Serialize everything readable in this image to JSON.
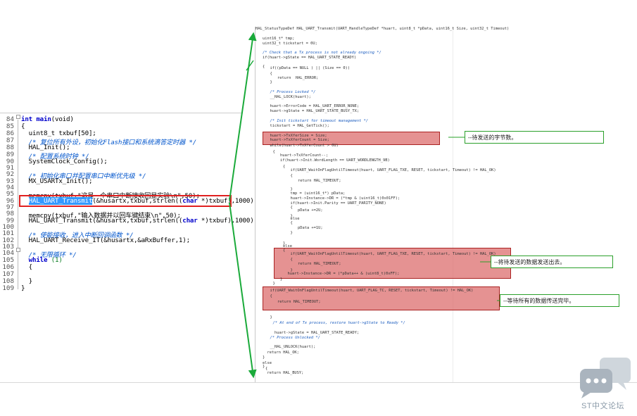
{
  "editor": {
    "line_numbers": [
      "84",
      "85",
      "86",
      "87",
      "88",
      "89",
      "90",
      "91",
      "92",
      "93",
      "94",
      "95",
      "96",
      "97",
      "98",
      "99",
      "100",
      "101",
      "102",
      "103",
      "104",
      "105",
      "106",
      "107",
      "108",
      "109"
    ],
    "lines": {
      "l84_kw1": "int",
      "l84_kw2": "main",
      "l84_rest": "(void)",
      "l85": "{",
      "l86": "  uint8_t txbuf[50];",
      "l87": "  /* 复位所有外设，初始化Flash接口和系统滴答定时器 */",
      "l88": "  HAL_Init();",
      "l89": "  /* 配置系统时钟 */",
      "l90": "  SystemClock_Config();",
      "l92": "  /* 初始化串口并配置串口中断优先级 */",
      "l93": "  MX_USARTx_Init();",
      "l95": "  memcpy(txbuf,\"这是一个串口中断接收回显实验\\n\",50);",
      "l96_sel": "HAL_UART_Transmit",
      "l96_rest_a": "(&husartx,txbuf,strlen((",
      "l96_kw": "char",
      "l96_rest_b": " *)txbuf),1000);",
      "l98": "  memcpy(txbuf,\"输入数据并以回车键结束\\n\",50);",
      "l99_a": "  HAL_UART_Transmit(&husartx,txbuf,strlen((",
      "l99_kw": "char",
      "l99_b": " *)txbuf),1000);",
      "l101": "  /* 使能接收，进入中断回调函数 */",
      "l102": "  HAL_UART_Receive_IT(&husartx,&aRxBuffer,1);",
      "l104": "  /* 无限循环 */",
      "l105_kw": "while",
      "l105_rest": " (1)",
      "l106": "  {",
      "l108": "  }",
      "l109": "}"
    }
  },
  "source": {
    "lines": [
      "HAL_StatusTypeDef HAL_UART_Transmit(UART_HandleTypeDef *huart, uint8_t *pData, uint16_t Size, uint32_t Timeout)",
      "uint16_t* tmp;",
      "uint32_t tickstart = 0U;",
      "/* Check that a Tx process is not already ongoing */",
      "if(huart->gState == HAL_UART_STATE_READY)",
      "{",
      "  if((pData == NULL ) || (Size == 0))",
      "  {",
      "    return  HAL_ERROR;",
      "  }",
      "  /* Process Locked */",
      "  __HAL_LOCK(huart);",
      "  huart->ErrorCode = HAL_UART_ERROR_NONE;",
      "  huart->gState = HAL_UART_STATE_BUSY_TX;",
      "  /* Init tickstart for timeout management */",
      "  tickstart = HAL_GetTick();",
      "  huart->TxXferSize = Size;",
      "  huart->TxXferCount = Size;",
      "  while(huart->TxXferCount > 0U)",
      "  {",
      "    huart->TxXferCount--;",
      "    if(huart->Init.WordLength == UART_WORDLENGTH_9B)",
      "    {",
      "      if(UART_WaitOnFlagUntilTimeout(huart, UART_FLAG_TXE, RESET, tickstart, Timeout) != HAL_OK)",
      "      {",
      "        return HAL_TIMEOUT;",
      "      }",
      "      tmp = (uint16_t*) pData;",
      "      huart->Instance->DR = (*tmp & (uint16_t)0x01FF);",
      "      if(huart->Init.Parity == UART_PARITY_NONE)",
      "      {",
      "        pData +=2U;",
      "      }",
      "      else",
      "      {",
      "        pData +=1U;",
      "      }",
      "    }",
      "    else",
      "    {",
      "      if(UART_WaitOnFlagUntilTimeout(huart, UART_FLAG_TXE, RESET, tickstart, Timeout) != HAL_OK)",
      "      {",
      "        return HAL_TIMEOUT;",
      "      }",
      "      huart->Instance->DR = (*pData++ & (uint8_t)0xFF);",
      "    }",
      "  }",
      "  if(UART_WaitOnFlagUntilTimeout(huart, UART_FLAG_TC, RESET, tickstart, Timeout) != HAL_OK)",
      "  {",
      "    return HAL_TIMEOUT;",
      "  }",
      "  /* At end of Tx process, restore huart->gState to Ready */",
      "    huart->gState = HAL_UART_STATE_READY;",
      "  /* Process Unlocked */",
      "  __HAL_UNLOCK(huart);",
      "  return HAL_OK;",
      "}",
      "else",
      "{",
      "  return HAL_BUSY;",
      "}"
    ]
  },
  "annotations": {
    "note1": "--待发送的字节数。",
    "note2": "--将待发送的数据发送出去。",
    "note3": "--等待所有的数据传送完毕。"
  },
  "forum": {
    "label": "ST中文论坛"
  },
  "colors": {
    "highlight_box": "#e02020",
    "arrow": "#1aaa3a",
    "note_border": "#2aa02a",
    "code_keyword": "#0000cc",
    "code_comment": "#0055cc",
    "red_fill": "#dc6e6e"
  }
}
